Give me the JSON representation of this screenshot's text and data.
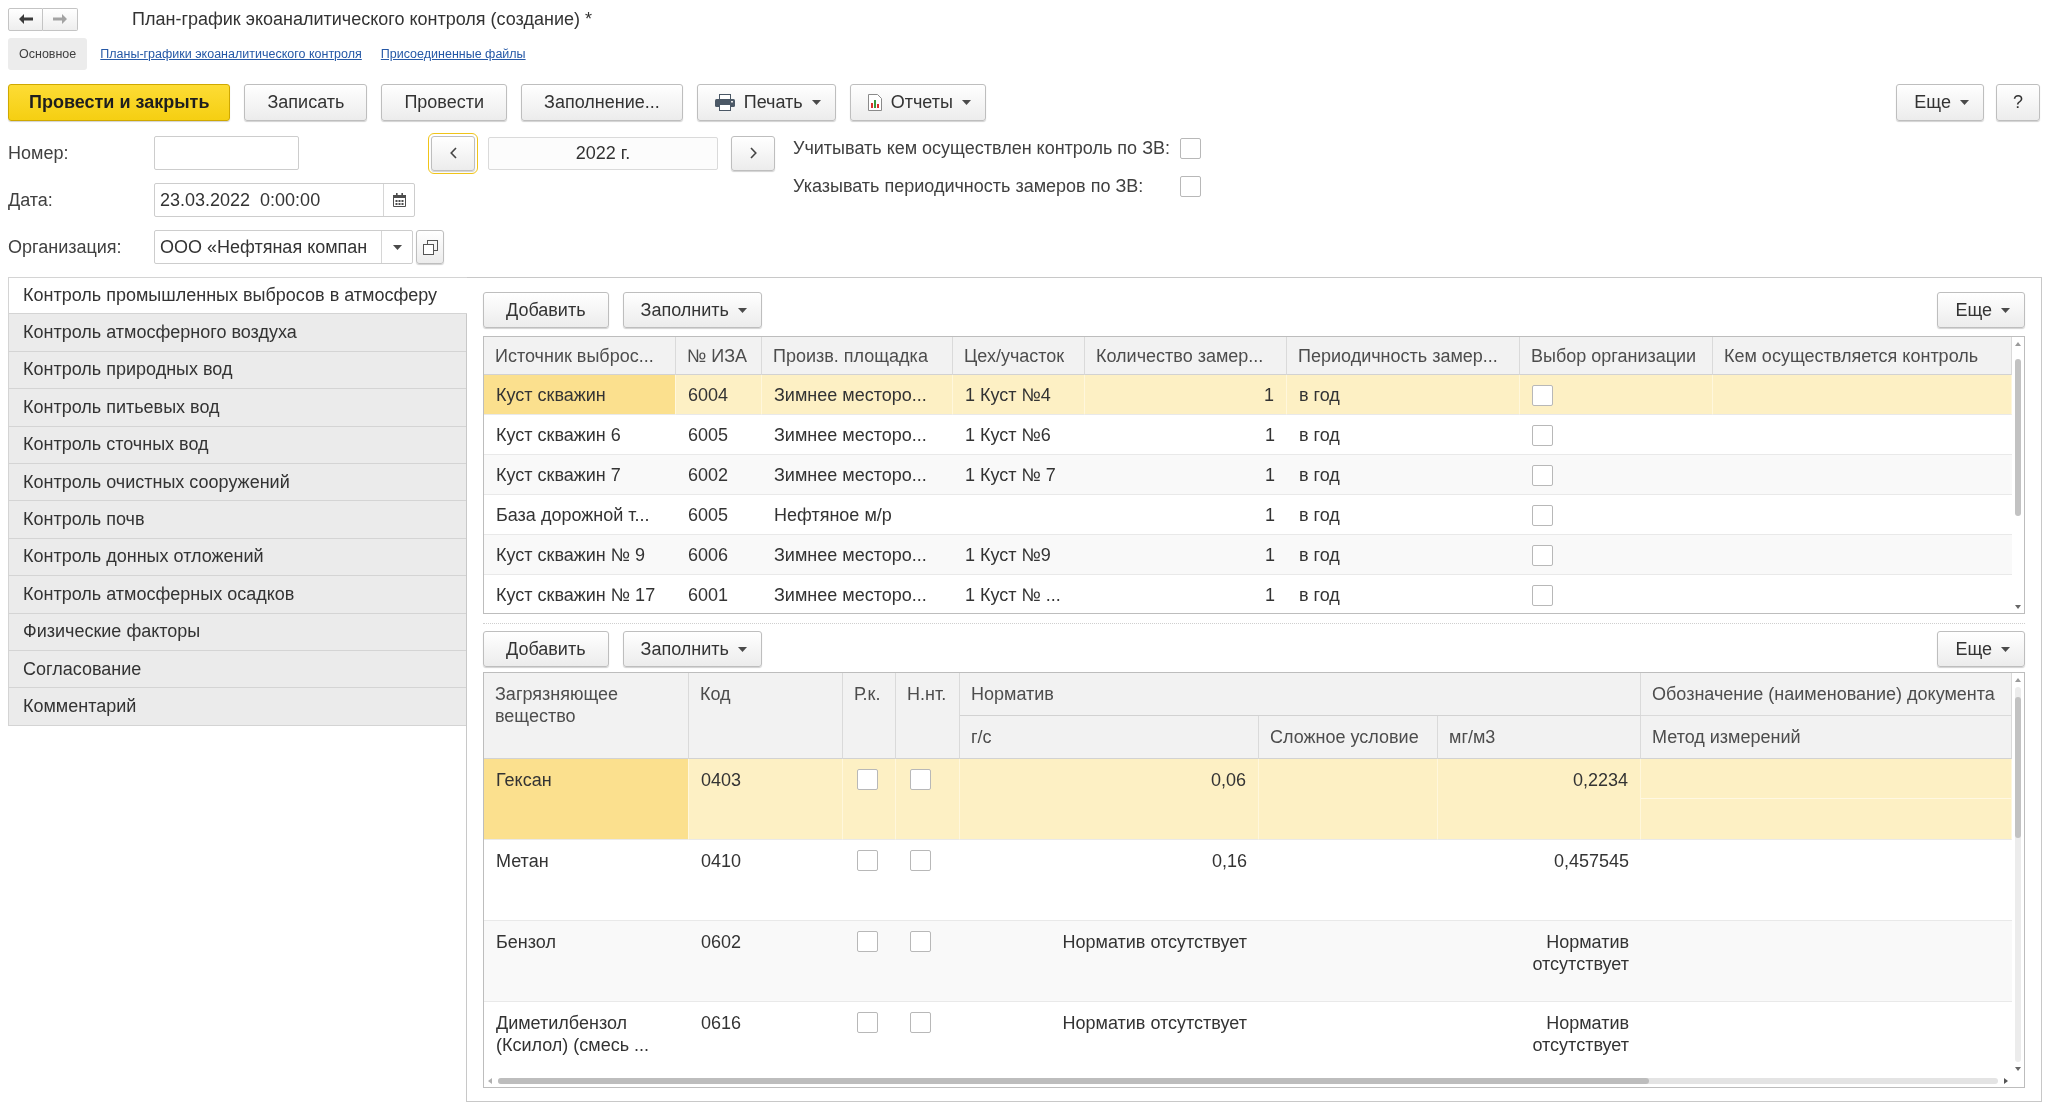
{
  "window": {
    "nav": [
      {
        "kind": "back",
        "disabled": false
      },
      {
        "kind": "forward",
        "disabled": true
      }
    ],
    "title": "План-график экоаналитического контроля (создание) *"
  },
  "tabs": [
    {
      "label": "Основное",
      "selected": true
    },
    {
      "label": "Планы-графики экоаналитического контроля",
      "selected": false
    },
    {
      "label": "Присоединенные файлы",
      "selected": false
    }
  ],
  "toolbar": {
    "buttons": [
      {
        "label": "Провести и закрыть",
        "kind": "primary"
      },
      {
        "label": "Записать",
        "kind": "plain"
      },
      {
        "label": "Провести",
        "kind": "plain"
      },
      {
        "label": "Заполнение...",
        "kind": "plain"
      },
      {
        "label": "Печать",
        "kind": "print"
      },
      {
        "label": "Отчеты",
        "kind": "report"
      }
    ],
    "right_buttons": [
      {
        "label": "Еще",
        "kind": "menu"
      },
      {
        "label": "?",
        "kind": "help"
      }
    ]
  },
  "form": {
    "number": {
      "label": "Номер:"
    },
    "period": {
      "value": "2022 г.",
      "prev_button": {
        "focused": true
      }
    },
    "options": [
      {
        "label": "Учитывать кем осуществлен контроль по ЗВ:",
        "checked": false
      },
      {
        "label": "Указывать периодичность замеров по ЗВ:",
        "checked": false
      }
    ],
    "date": {
      "label": "Дата:",
      "value": "23.03.2022  0:00:00"
    },
    "organization": {
      "label": "Организация:",
      "value": "ООО «Нефтяная компан"
    }
  },
  "sections": [
    {
      "label": "Контроль промышленных выбросов в атмосферу",
      "selected": true
    },
    {
      "label": "Контроль атмосферного воздуха",
      "selected": false
    },
    {
      "label": "Контроль природных вод",
      "selected": false
    },
    {
      "label": "Контроль питьевых вод",
      "selected": false
    },
    {
      "label": "Контроль сточных вод",
      "selected": false
    },
    {
      "label": "Контроль очистных сооружений",
      "selected": false
    },
    {
      "label": "Контроль почв",
      "selected": false
    },
    {
      "label": "Контроль донных отложений",
      "selected": false
    },
    {
      "label": "Контроль атмосферных осадков",
      "selected": false
    },
    {
      "label": "Физические факторы",
      "selected": false
    },
    {
      "label": "Согласование",
      "selected": false
    },
    {
      "label": "Комментарий",
      "selected": false
    }
  ],
  "emissions": {
    "toolbar": {
      "buttons": [
        {
          "label": "Добавить",
          "kind": "plain"
        },
        {
          "label": "Заполнить",
          "kind": "menu"
        }
      ],
      "right_buttons": [
        {
          "label": "Еще",
          "kind": "menu"
        }
      ]
    },
    "columns": [
      {
        "label": "Источник выброс...",
        "kind": "text"
      },
      {
        "label": "№ ИЗА",
        "kind": "text"
      },
      {
        "label": "Произв. площадка",
        "kind": "text"
      },
      {
        "label": "Цех/участок",
        "kind": "text"
      },
      {
        "label": "Количество замер...",
        "kind": "number"
      },
      {
        "label": "Периодичность замер...",
        "kind": "text"
      },
      {
        "label": "Выбор организации",
        "kind": "checkbox"
      },
      {
        "label": "Кем осуществляется контроль",
        "kind": "text"
      }
    ],
    "rows": [
      {
        "source": "Куст скважин",
        "iza": "6004",
        "site": "Зимнее месторо...",
        "workshop": "1 Куст №4",
        "count": "1",
        "periodicity": "в год",
        "org_choice": false,
        "selected": true
      },
      {
        "source": "Куст скважин 6",
        "iza": "6005",
        "site": "Зимнее месторо...",
        "workshop": "1 Куст №6",
        "count": "1",
        "periodicity": "в год",
        "org_choice": false,
        "selected": false
      },
      {
        "source": "Куст скважин 7",
        "iza": "6002",
        "site": "Зимнее месторо...",
        "workshop": "1 Куст № 7",
        "count": "1",
        "periodicity": "в год",
        "org_choice": false,
        "selected": false
      },
      {
        "source": "База дорожной т...",
        "iza": "6005",
        "site": "Нефтяное м/р",
        "count": "1",
        "periodicity": "в год",
        "org_choice": false,
        "selected": false
      },
      {
        "source": "Куст скважин № 9",
        "iza": "6006",
        "site": "Зимнее месторо...",
        "workshop": "1 Куст №9",
        "count": "1",
        "periodicity": "в год",
        "org_choice": false,
        "selected": false
      },
      {
        "source": "Куст скважин № 17",
        "iza": "6001",
        "site": "Зимнее месторо...",
        "workshop": "1 Куст № ...",
        "count": "1",
        "periodicity": "в год",
        "org_choice": false,
        "selected": false
      }
    ]
  },
  "pollutants": {
    "toolbar": {
      "buttons": [
        {
          "label": "Добавить",
          "kind": "plain"
        },
        {
          "label": "Заполнить",
          "kind": "menu"
        }
      ],
      "right_buttons": [
        {
          "label": "Еще",
          "kind": "menu"
        }
      ]
    },
    "columns": [
      {
        "label": "Загрязняющее вещество",
        "kind": "text"
      },
      {
        "label": "Код",
        "kind": "text"
      },
      {
        "label": "Р.к.",
        "kind": "checkbox"
      },
      {
        "label": "Н.нт.",
        "kind": "checkbox"
      },
      {
        "label": "Норматив",
        "children": [
          {
            "label": "г/с",
            "kind": "number"
          },
          {
            "label": "Сложное условие",
            "kind": "text"
          },
          {
            "label": "мг/м3",
            "kind": "number"
          }
        ]
      },
      {
        "label": "Обозначение (наименование) документа",
        "sublabel": "Метод измерений",
        "kind": "stacked"
      }
    ],
    "rows": [
      {
        "substance": "Гексан",
        "code": "0403",
        "rk": false,
        "nnt": false,
        "gs": "0,06",
        "mgm3": "0,2234",
        "selected": true
      },
      {
        "substance": "Метан",
        "code": "0410",
        "rk": false,
        "nnt": false,
        "gs": "0,16",
        "mgm3": "0,457545",
        "selected": false
      },
      {
        "substance": "Бензол",
        "code": "0602",
        "rk": false,
        "nnt": false,
        "gs": "Норматив отсутствует",
        "mgm3": "Норматив отсутствует",
        "selected": false
      },
      {
        "substance": "Диметилбензол (Ксилол) (смесь ...",
        "code": "0616",
        "rk": false,
        "nnt": false,
        "gs": "Норматив отсутствует",
        "mgm3": "Норматив отсутствует",
        "selected": false
      }
    ]
  }
}
